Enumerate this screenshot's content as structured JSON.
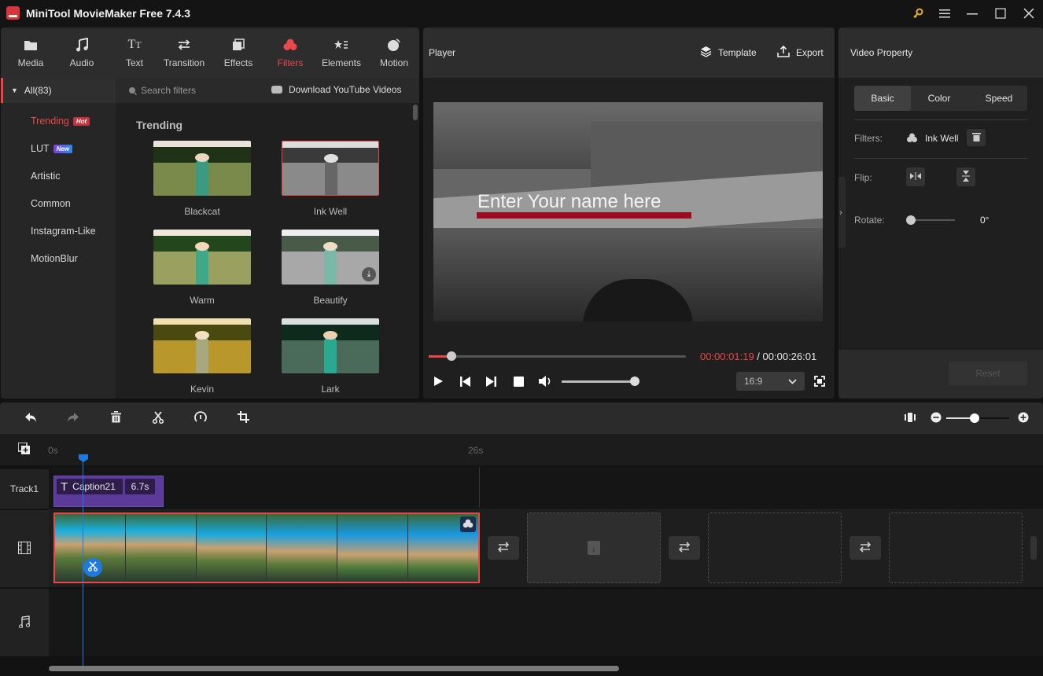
{
  "app": {
    "title": "MiniTool MovieMaker Free 7.4.3"
  },
  "window_controls": {
    "key": "activate-key-icon",
    "menu": "menu-icon",
    "minimize": "minimize-icon",
    "maximize": "maximize-icon",
    "close": "close-icon"
  },
  "toolbar": {
    "tabs": [
      {
        "label": "Media",
        "icon": "folder-icon"
      },
      {
        "label": "Audio",
        "icon": "music-icon"
      },
      {
        "label": "Text",
        "icon": "text-icon"
      },
      {
        "label": "Transition",
        "icon": "transition-icon"
      },
      {
        "label": "Effects",
        "icon": "effects-icon"
      },
      {
        "label": "Filters",
        "icon": "filters-icon",
        "active": true
      },
      {
        "label": "Elements",
        "icon": "elements-icon"
      },
      {
        "label": "Motion",
        "icon": "motion-icon"
      }
    ]
  },
  "filters_panel": {
    "all_label": "All(83)",
    "search_placeholder": "Search filters",
    "download_label": "Download YouTube Videos",
    "categories": [
      {
        "label": "Trending",
        "badge": "Hot",
        "active": true
      },
      {
        "label": "LUT",
        "badge": "New"
      },
      {
        "label": "Artistic"
      },
      {
        "label": "Common"
      },
      {
        "label": "Instagram-Like"
      },
      {
        "label": "MotionBlur"
      }
    ],
    "section_title": "Trending",
    "items": [
      {
        "label": "Blackcat",
        "selected": false,
        "download": false
      },
      {
        "label": "Ink Well",
        "selected": true,
        "download": false
      },
      {
        "label": "Warm",
        "selected": false,
        "download": false
      },
      {
        "label": "Beautify",
        "selected": false,
        "download": true
      },
      {
        "label": "Kevin",
        "selected": false,
        "download": false
      },
      {
        "label": "Lark",
        "selected": false,
        "download": false
      }
    ]
  },
  "player": {
    "title": "Player",
    "template_label": "Template",
    "export_label": "Export",
    "caption_text": "Enter Your name here",
    "current_time": "00:00:01:19",
    "separator": " / ",
    "total_time": "00:00:26:01",
    "progress_fraction": 0.03,
    "volume_fraction": 1.0,
    "aspect_ratio": "16:9"
  },
  "property": {
    "title": "Video Property",
    "tabs": [
      {
        "label": "Basic",
        "active": true
      },
      {
        "label": "Color"
      },
      {
        "label": "Speed"
      }
    ],
    "filters_label": "Filters:",
    "filter_value": "Ink Well",
    "flip_label": "Flip:",
    "rotate_label": "Rotate:",
    "rotate_value": "0°",
    "reset_label": "Reset"
  },
  "timeline": {
    "ruler_start": "0s",
    "ruler_end": "26s",
    "track1_label": "Track1",
    "caption_clip": {
      "name": "Caption21",
      "duration": "6.7s"
    },
    "zoom_fraction": 0.45
  },
  "colors": {
    "accent": "#e8484a",
    "playhead": "#1e7ae0",
    "caption_clip": "#5b3a9a"
  }
}
